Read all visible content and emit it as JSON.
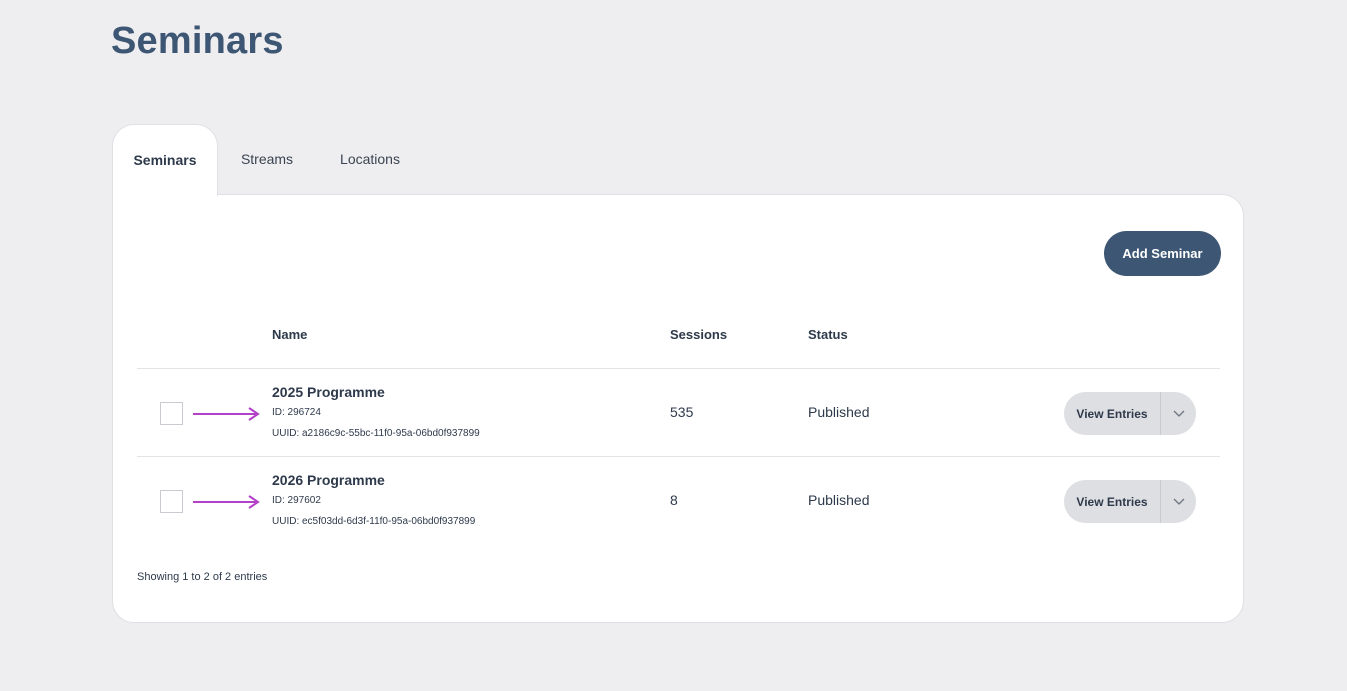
{
  "page": {
    "title": "Seminars"
  },
  "tabs": [
    {
      "label": "Seminars",
      "active": true
    },
    {
      "label": "Streams",
      "active": false
    },
    {
      "label": "Locations",
      "active": false
    }
  ],
  "toolbar": {
    "add_label": "Add Seminar"
  },
  "table": {
    "columns": {
      "name": "Name",
      "sessions": "Sessions",
      "status": "Status"
    },
    "rows": [
      {
        "name": "2025 Programme",
        "id": "ID: 296724",
        "uuid": "UUID: a2186c9c-55bc-11f0-95a-06bd0f937899",
        "sessions": "535",
        "status": "Published",
        "action": "View Entries"
      },
      {
        "name": "2026 Programme",
        "id": "ID: 297602",
        "uuid": "UUID: ec5f03dd-6d3f-11f0-95a-06bd0f937899",
        "sessions": "8",
        "status": "Published",
        "action": "View Entries"
      }
    ]
  },
  "footer": {
    "showing": "Showing 1 to 2 of 2 entries"
  },
  "colors": {
    "brand": "#3d5673",
    "annotation_arrow": "#b43fc8",
    "background": "#eeeef0"
  },
  "icons": {
    "row_arrow": "right-arrow-annotation",
    "dropdown": "chevron-down-icon"
  }
}
